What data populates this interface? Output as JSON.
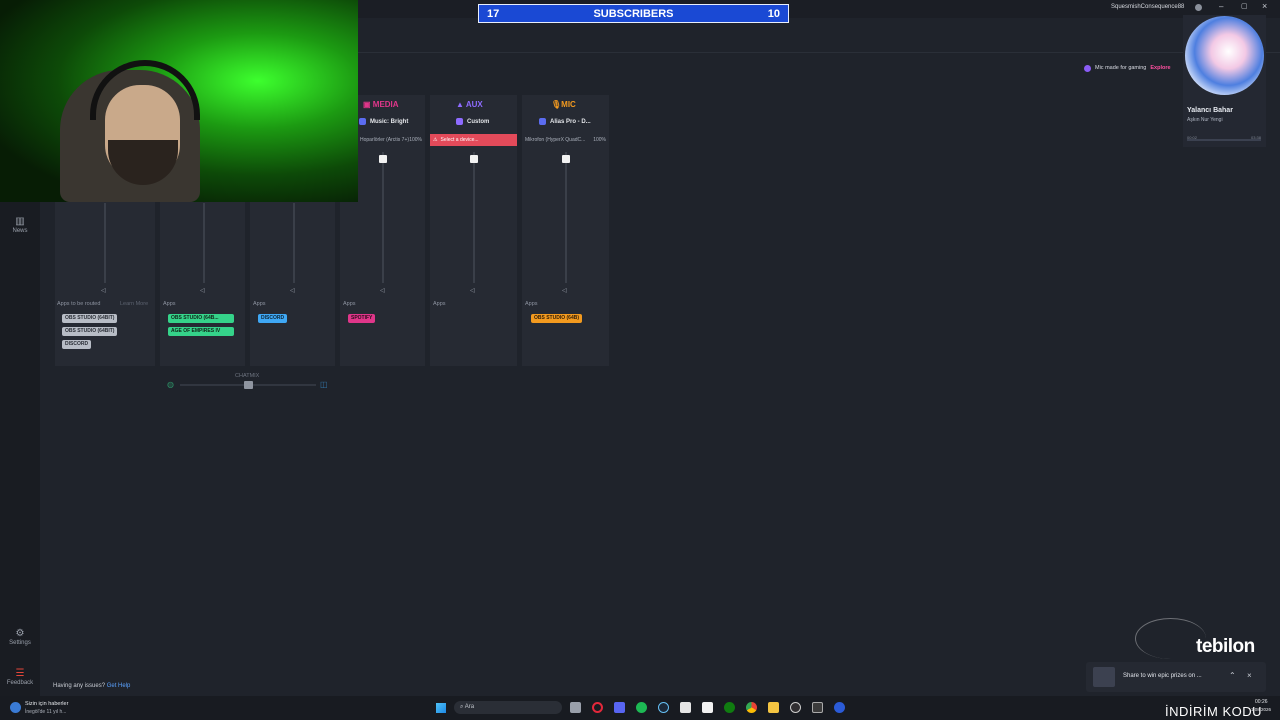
{
  "overlay": {
    "subs_left": "17",
    "subs_label": "SUBSCRIBERS",
    "subs_right": "10",
    "brand": "tebilon",
    "promo_code": "İNDİRİM KODU"
  },
  "window": {
    "user": "SquesmishConsequence88",
    "min": "–",
    "max": "▢",
    "close": "×"
  },
  "promo_banner": {
    "text": "Mic made for gaming",
    "link": "Explore"
  },
  "music": {
    "title": "Yalancı Bahar",
    "artist": "Aşkın Nur Yengi",
    "time_left": "00:02",
    "time_right": "03:38"
  },
  "sidebar": {
    "news": "News",
    "settings": "Settings",
    "feedback": "Feedback"
  },
  "footer": {
    "issues": "Having any issues?",
    "help": "Get Help"
  },
  "mixer": {
    "apps_routed_label": "Apps to be routed",
    "learn_more": "Learn More",
    "apps_label": "Apps",
    "chatmix_label": "CHATMIX",
    "channels": [
      {
        "title": "MEDIA",
        "preset": "Music: Bright",
        "device": "Hoparlörler (Arctis 7+)",
        "level": "100%",
        "color": "#e0368a"
      },
      {
        "title": "AUX",
        "preset": "Custom",
        "device": "Select a device...",
        "level": "",
        "color": "#8e6bff"
      },
      {
        "title": "MIC",
        "preset": "Alias Pro - D...",
        "device": "Mikrofon (HyperX QuadC...",
        "level": "100%",
        "color": "#f39a1f"
      }
    ],
    "unrouted_chips": [
      "OBS STUDIO (64BIT)",
      "OBS STUDIO (64BIT)",
      "DISCORD"
    ],
    "game_chips": [
      "OBS STUDIO (64B...",
      "AGE OF EMPIRES IV"
    ],
    "chat_chips": [
      "DISCORD"
    ],
    "media_chips": [
      "SPOTIFY"
    ],
    "mic_chips": [
      "OBS STUDIO (64B)"
    ]
  },
  "toast": {
    "text": "Share to win epic prizes on ..."
  },
  "news_widget": {
    "title": "Sizin için haberler",
    "subtitle": "İnegöl'de 11 yıl h..."
  },
  "taskbar": {
    "search": "Ara",
    "clock": "00:26",
    "date": "1.08.2026"
  },
  "colors": {
    "accent_blue": "#1a49d4",
    "game_green": "#35d38a",
    "chat_blue": "#3fa8f5",
    "media_pink": "#e0368a",
    "mic_orange": "#f39a1f",
    "error_red": "#e34a5a"
  }
}
